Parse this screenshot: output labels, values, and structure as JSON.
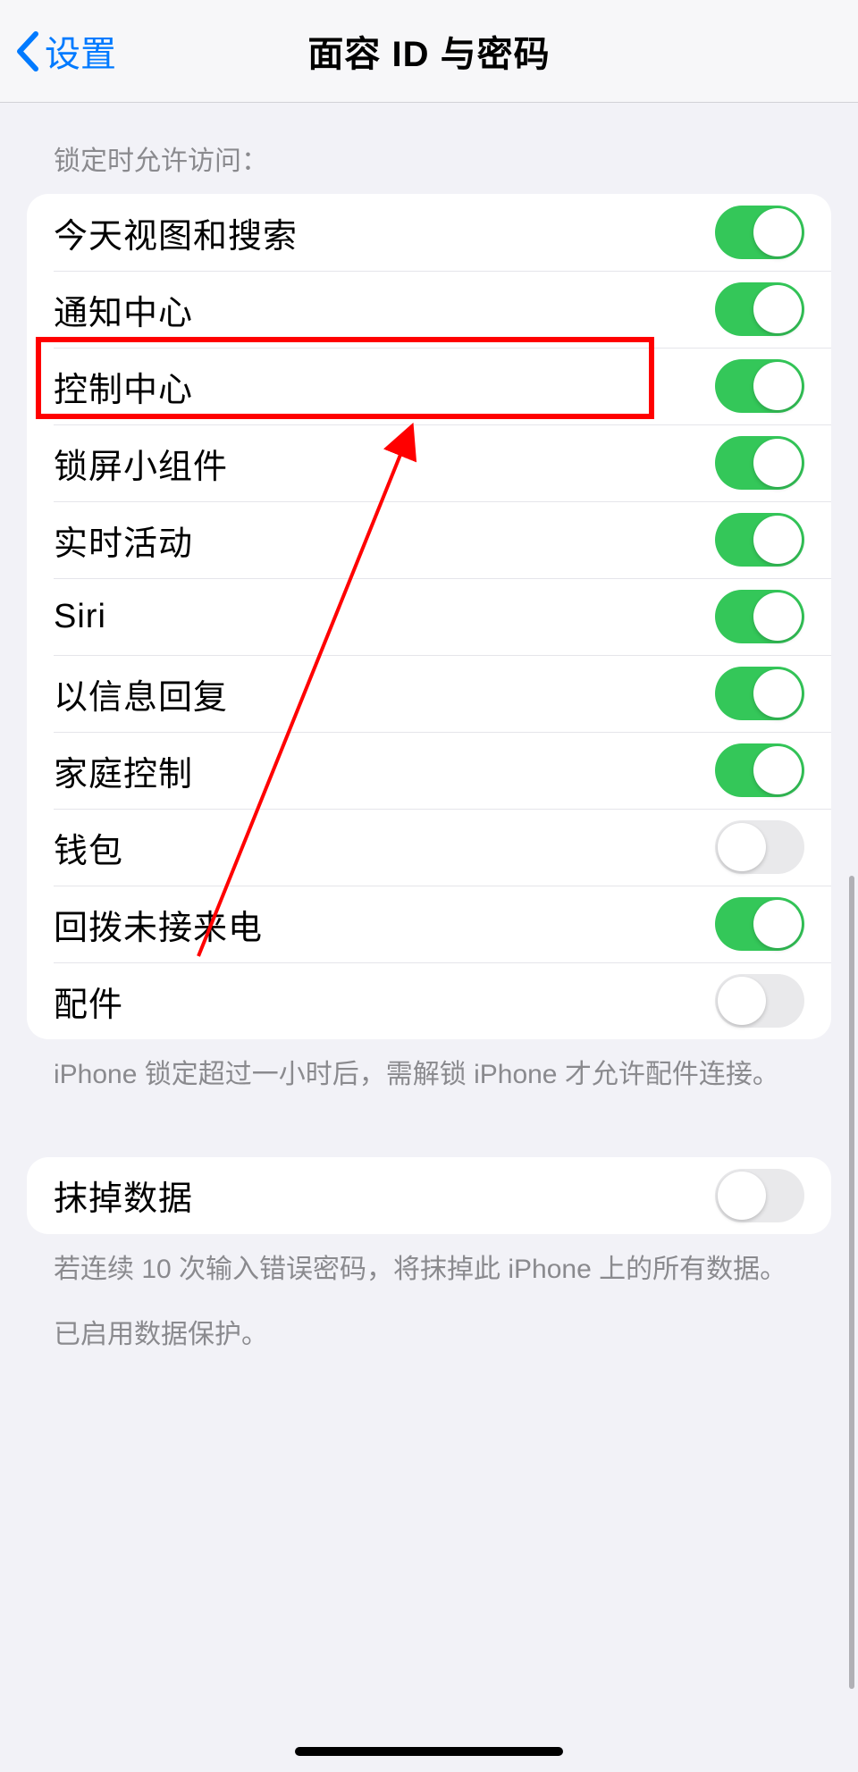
{
  "nav": {
    "back_label": "设置",
    "title": "面容 ID 与密码"
  },
  "section1": {
    "header": "锁定时允许访问：",
    "items": [
      {
        "label": "今天视图和搜索",
        "on": true
      },
      {
        "label": "通知中心",
        "on": true
      },
      {
        "label": "控制中心",
        "on": true,
        "highlighted": true
      },
      {
        "label": "锁屏小组件",
        "on": true
      },
      {
        "label": "实时活动",
        "on": true
      },
      {
        "label": "Siri",
        "on": true
      },
      {
        "label": "以信息回复",
        "on": true
      },
      {
        "label": "家庭控制",
        "on": true
      },
      {
        "label": "钱包",
        "on": false
      },
      {
        "label": "回拨未接来电",
        "on": true
      },
      {
        "label": "配件",
        "on": false
      }
    ],
    "footer": "iPhone 锁定超过一小时后，需解锁 iPhone 才允许配件连接。"
  },
  "section2": {
    "items": [
      {
        "label": "抹掉数据",
        "on": false
      }
    ],
    "footer1": "若连续 10 次输入错误密码，将抹掉此 iPhone 上的所有数据。",
    "footer2": "已启用数据保护。"
  }
}
